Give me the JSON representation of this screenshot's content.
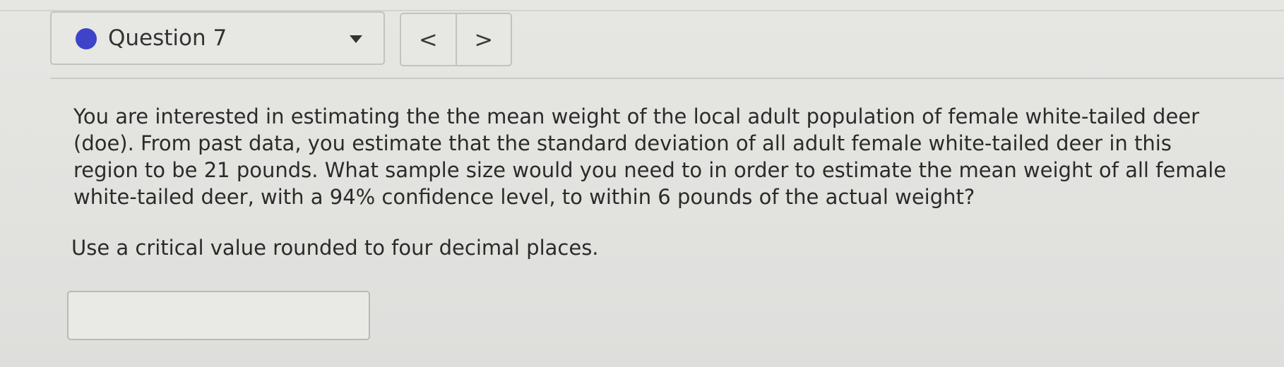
{
  "header": {
    "question_title": "Question 7",
    "status_color": "#3f43c9",
    "dropdown_icon": "triangle-down-icon",
    "nav": {
      "prev_label": "<",
      "next_label": ">"
    }
  },
  "question": {
    "body": "You are interested in estimating the the mean weight of the local adult population of female white-tailed deer (doe). From past data, you estimate that the standard deviation of all adult female white-tailed deer in this region to be 21 pounds. What sample size would you need to in order to estimate the mean weight of all female white-tailed deer, with a 94% confidence level, to within 6 pounds of the actual weight?",
    "instruction": "Use a critical value rounded to four decimal places."
  },
  "answer": {
    "value": ""
  }
}
